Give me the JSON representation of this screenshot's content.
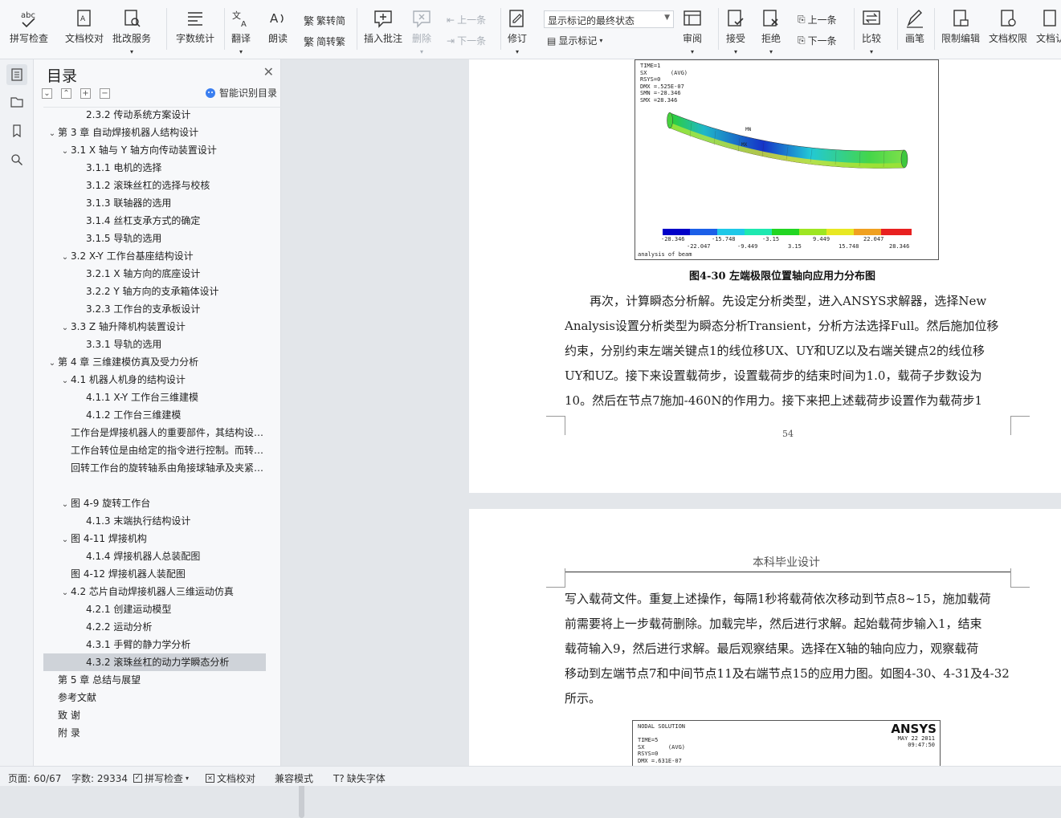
{
  "ribbon": {
    "spell_check": "拼写检查",
    "doc_proof": "文档校对",
    "annotation_service": "批改服务",
    "word_count": "字数统计",
    "translate": "翻译",
    "read_aloud": "朗读",
    "to_traditional": "繁转简",
    "to_simplified": "简转繁",
    "insert_comment": "插入批注",
    "delete": "删除",
    "prev_comment": "上一条",
    "next_comment": "下一条",
    "revise": "修订",
    "markup_state": "显示标记的最终状态",
    "show_markup": "显示标记",
    "review": "审阅",
    "accept": "接受",
    "reject": "拒绝",
    "prev_change": "上一条",
    "next_change": "下一条",
    "compare": "比较",
    "pen": "画笔",
    "restrict_edit": "限制编辑",
    "doc_permission": "文档权限",
    "doc_more": "文档认"
  },
  "toc": {
    "title": "目录",
    "smart": "智能识别目录",
    "items": [
      {
        "level": 3,
        "chev": "",
        "text": "2.3.2  传动系统方案设计"
      },
      {
        "level": 1,
        "chev": "v",
        "text": "第 3 章   自动焊接机器人结构设计"
      },
      {
        "level": 2,
        "chev": "v",
        "text": "3.1 X 轴与 Y 轴方向传动装置设计"
      },
      {
        "level": 3,
        "chev": "",
        "text": "3.1.1  电机的选择"
      },
      {
        "level": 3,
        "chev": "",
        "text": "3.1.2 滚珠丝杠的选择与校核"
      },
      {
        "level": 3,
        "chev": "",
        "text": "3.1.3  联轴器的选用"
      },
      {
        "level": 3,
        "chev": "",
        "text": "3.1.4  丝杠支承方式的确定"
      },
      {
        "level": 3,
        "chev": "",
        "text": "3.1.5  导轨的选用"
      },
      {
        "level": 2,
        "chev": "v",
        "text": "3.2    X-Y 工作台基座结构设计"
      },
      {
        "level": 3,
        "chev": "",
        "text": "3.2.1    X 轴方向的底座设计"
      },
      {
        "level": 3,
        "chev": "",
        "text": "3.2.2    Y 轴方向的支承箱体设计"
      },
      {
        "level": 3,
        "chev": "",
        "text": "3.2.3    工作台的支承板设计"
      },
      {
        "level": 2,
        "chev": "v",
        "text": "3.3    Z 轴升降机构装置设计"
      },
      {
        "level": 3,
        "chev": "",
        "text": "3.3.1  导轨的选用"
      },
      {
        "level": 1,
        "chev": "v",
        "text": "第 4 章  三维建模仿真及受力分析"
      },
      {
        "level": 2,
        "chev": "v",
        "text": "4.1  机器人机身的结构设计"
      },
      {
        "level": 3,
        "chev": "",
        "text": "4.1.1    X-Y 工作台三维建模"
      },
      {
        "level": 3,
        "chev": "",
        "text": "4.1.2    工作台三维建模"
      },
      {
        "level": 2,
        "chev": "",
        "text": "工作台是焊接机器人的重要部件，其结构设计直接影响"
      },
      {
        "level": 2,
        "chev": "",
        "text": "工作台转位是由给定的指令进行控制。而转位结构分析"
      },
      {
        "level": 2,
        "chev": "",
        "text": "回转工作台的旋转轴系由角接球轴承及夹紧机构组成的"
      },
      {
        "level": 2,
        "chev": "",
        "text": ""
      },
      {
        "level": 2,
        "chev": "v",
        "text": "图 4-9      旋转工作台"
      },
      {
        "level": 3,
        "chev": "",
        "text": "4.1.3    末端执行结构设计"
      },
      {
        "level": 2,
        "chev": "v",
        "text": "图 4-11      焊接机构"
      },
      {
        "level": 3,
        "chev": "",
        "text": "4.1.4    焊接机器人总装配图"
      },
      {
        "level": 2,
        "chev": "",
        "text": "图 4-12      焊接机器人装配图"
      },
      {
        "level": 2,
        "chev": "v",
        "text": "4.2  芯片自动焊接机器人三维运动仿真"
      },
      {
        "level": 3,
        "chev": "",
        "text": "4.2.1  创建运动模型"
      },
      {
        "level": 3,
        "chev": "",
        "text": "4.2.2  运动分析"
      },
      {
        "level": 3,
        "chev": "",
        "text": "4.3.1  手臂的静力学分析"
      },
      {
        "level": 3,
        "chev": "",
        "text": "4.3.2  滚珠丝杠的动力学瞬态分析",
        "selected": true
      },
      {
        "level": 1,
        "chev": "",
        "text": "第 5 章  总结与展望"
      },
      {
        "level": 1,
        "chev": "",
        "text": "参考文献"
      },
      {
        "level": 1,
        "chev": "",
        "text": "致    谢"
      },
      {
        "level": 1,
        "chev": "",
        "text": "附    录"
      }
    ]
  },
  "doc": {
    "fig1": {
      "info": "TIME=1\nSX       (AVG)\nRSYS=0\nDMX =.525E-07\nSMN =-28.346\nSMX =28.346",
      "mn_label": "MN",
      "mx_label": "MX",
      "legend_top": [
        "-28.346",
        "-15.748",
        "-3.15",
        "9.449",
        "22.047"
      ],
      "legend_bottom": [
        "-22.047",
        "-9.449",
        "3.15",
        "15.748",
        "28.346"
      ],
      "footer": "analysis of beam"
    },
    "caption": "图4-30  左端极限位置轴向应用力分布图",
    "para1": [
      "再次，计算瞬态分析解。先设定分析类型，进入ANSYS求解器，选择New",
      "Analysis设置分析类型为瞬态分析Transient，分析方法选择Full。然后施加位移",
      "约束，分别约束左端关键点1的线位移UX、UY和UZ以及右端关键点2的线位移",
      "UY和UZ。接下来设置载荷步，设置载荷步的结束时间为1.0，载荷子步数设为",
      "10。然后在节点7施加-460N的作用力。接下来把上述载荷步设置作为载荷步1"
    ],
    "page_number": "54",
    "header": "本科毕业设计",
    "para2": [
      "写入载荷文件。重复上述操作，每隔1秒将载荷依次移动到节点8~15，施加载荷",
      "前需要将上一步载荷删除。加载完毕，然后进行求解。起始载荷步输入1，结束",
      "载荷输入9，然后进行求解。最后观察结果。选择在X轴的轴向应力，观察载荷",
      "移动到左端节点7和中间节点11及右端节点15的应用力图。如图4-30、4-31及4-32",
      "所示。"
    ],
    "fig2": {
      "info": "NODAL SOLUTION\n\nTIME=5\nSX       (AVG)\nRSYS=0\nDMX =.631E-07",
      "logo": "ANSYS",
      "date": "MAY 22 2011",
      "time": "09:47:50"
    }
  },
  "status": {
    "page": "页面: 60/67",
    "words": "字数: 29334",
    "spell": "拼写检查",
    "proof": "文档校对",
    "compat": "兼容模式",
    "missing_font": "缺失字体"
  }
}
